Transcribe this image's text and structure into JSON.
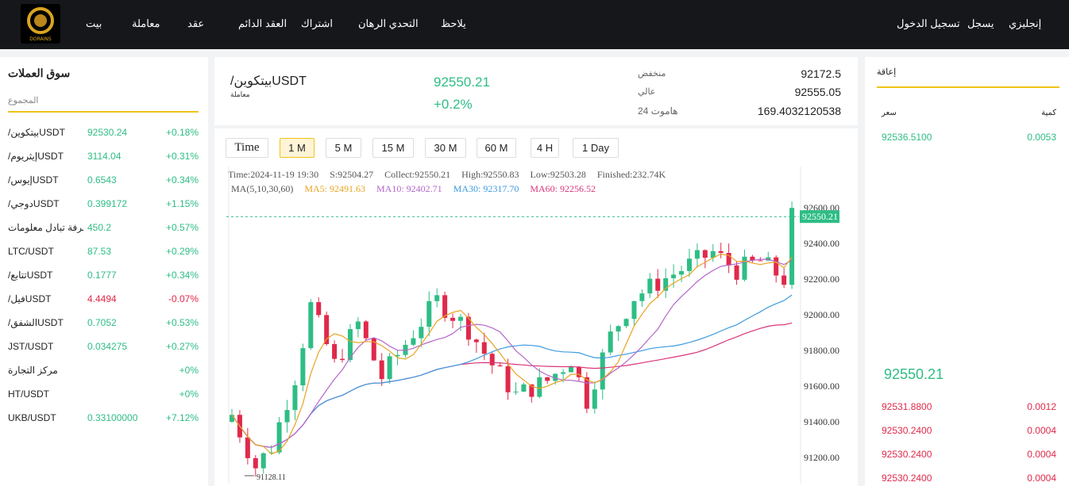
{
  "nav": {
    "logo_text": "DORAINS",
    "items": [
      "بيت",
      "معاملة",
      "عقد",
      "العقد الدائم",
      "اشتراك",
      "التحدي الرهان",
      "يلاحظ"
    ],
    "login": "تسجيل الدخول",
    "register": "يسجل",
    "language": "إنجليزي"
  },
  "market": {
    "title": "سوق العملات",
    "tab": "المجموع",
    "rows": [
      {
        "name": "/بيتكوينUSDT",
        "price": "92530.24",
        "change": "+0.18%",
        "down": false
      },
      {
        "name": "/إيثريومUSDT",
        "price": "3114.04",
        "change": "+0.31%",
        "down": false
      },
      {
        "name": "/إيوسUSDT",
        "price": "0.6543",
        "change": "+0.34%",
        "down": false
      },
      {
        "name": "/دوجيUSDT",
        "price": "0.399172",
        "change": "+1.15%",
        "down": false
      },
      {
        "name": "غرفة تبادل معلومات",
        "price": "450.2",
        "change": "+0.57%",
        "down": false
      },
      {
        "name": "LTC/USDT",
        "price": "87.53",
        "change": "+0.29%",
        "down": false
      },
      {
        "name": "/تتابعUSDT",
        "price": "0.1777",
        "change": "+0.34%",
        "down": false
      },
      {
        "name": "/فيلUSDT",
        "price": "4.4494",
        "change": "-0.07%",
        "down": true
      },
      {
        "name": "/الشفقUSDT",
        "price": "0.7052",
        "change": "+0.53%",
        "down": false
      },
      {
        "name": "JST/USDT",
        "price": "0.034275",
        "change": "+0.27%",
        "down": false
      },
      {
        "name": "مركز التجارة",
        "price": "",
        "change": "+0%",
        "down": false
      },
      {
        "name": "HT/USDT",
        "price": "",
        "change": "+0%",
        "down": false
      },
      {
        "name": "UKB/USDT",
        "price": "0.33100000",
        "change": "+7.12%",
        "down": false
      }
    ]
  },
  "ticker": {
    "pair": "/بيتكوينUSDT",
    "sub": "معاملة",
    "price": "92550.21",
    "change": "+0.2%",
    "low_label": "منخفض",
    "low": "92172.5",
    "high_label": "عالي",
    "high": "92555.05",
    "vol_label": "هاموت 24",
    "vol": "169.4032120538"
  },
  "timeframes": [
    "Time",
    "1 M",
    "5 M",
    "15 M",
    "30 M",
    "60 M",
    "4 H",
    "1 Day"
  ],
  "active_timeframe": "1 M",
  "info": {
    "time": "Time:2024-11-19 19:30",
    "s": "S:92504.27",
    "collect": "Collect:92550.21",
    "high": "High:92550.83",
    "low": "Low:92503.28",
    "finished": "Finished:232.74K",
    "ma_label": "MA(5,10,30,60)",
    "ma5": "MA5: 92491.63",
    "ma10": "MA10: 92402.71",
    "ma30": "MA30: 92317.70",
    "ma60": "MA60: 92256.52"
  },
  "chart_data": {
    "type": "candlestick",
    "y_ticks": [
      "92600.00",
      "92400.00",
      "92200.00",
      "92000.00",
      "91800.00",
      "91600.00",
      "91400.00",
      "91200.00"
    ],
    "ylim": [
      91100,
      92700
    ],
    "current_price": "92550.21",
    "min_label": "91128.11",
    "colors": {
      "up": "#2ebd85",
      "down": "#e0294a",
      "ma5": "#e8a320",
      "ma10": "#b566c9",
      "ma30": "#3d9be0",
      "ma60": "#d9357a"
    }
  },
  "orderbook": {
    "title": "إعاقة",
    "price_head": "سعر",
    "qty_head": "كمية",
    "buys": [
      {
        "price": "92536.5100",
        "qty": "0.0053"
      }
    ],
    "mid": "92550.21",
    "sells": [
      {
        "price": "92531.8800",
        "qty": "0.0012"
      },
      {
        "price": "92530.2400",
        "qty": "0.0004"
      },
      {
        "price": "92530.2400",
        "qty": "0.0004"
      },
      {
        "price": "92530.2400",
        "qty": "0.0004"
      }
    ]
  }
}
